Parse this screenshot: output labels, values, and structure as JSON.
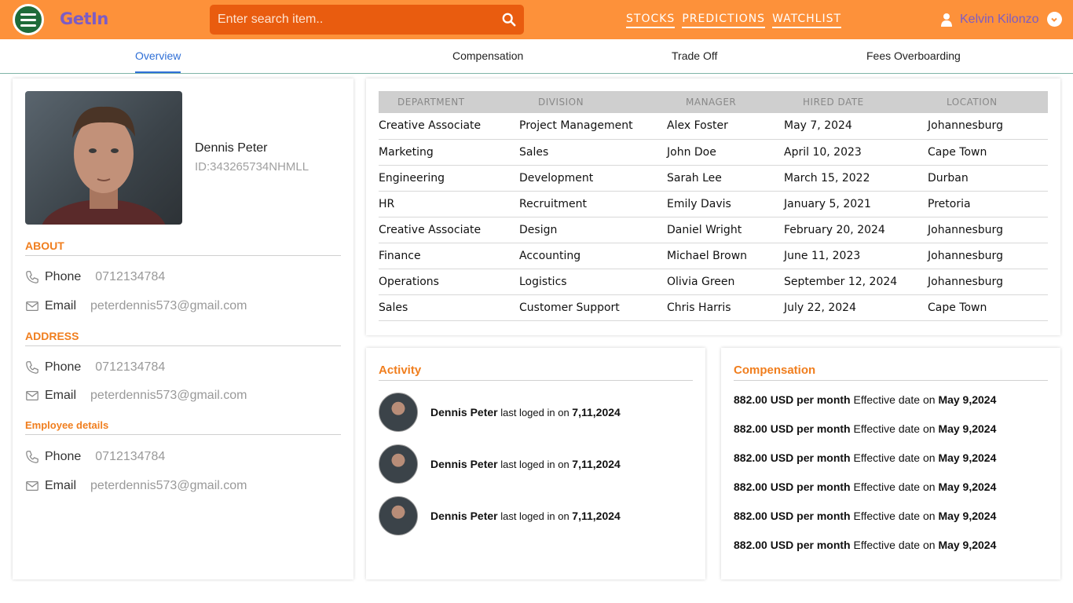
{
  "header": {
    "brand": "GetIn",
    "search_placeholder": "Enter search item..",
    "nav": [
      "STOCKS",
      "PREDICTIONS",
      "WATCHLIST"
    ],
    "user_name": "Kelvin Kilonzo"
  },
  "tabs": [
    "Overview",
    "Compensation",
    "Trade Off",
    "Fees Overboarding"
  ],
  "profile": {
    "name": "Dennis Peter",
    "id": "ID:343265734NHMLL",
    "sections": [
      {
        "title": "ABOUT",
        "phone_label": "Phone",
        "phone": "0712134784",
        "email_label": "Email",
        "email": "peterdennis573@gmail.com"
      },
      {
        "title": "ADDRESS",
        "phone_label": "Phone",
        "phone": "0712134784",
        "email_label": "Email",
        "email": "peterdennis573@gmail.com"
      },
      {
        "title": "Employee details",
        "phone_label": "Phone",
        "phone": "0712134784",
        "email_label": "Email",
        "email": "peterdennis573@gmail.com"
      }
    ]
  },
  "table": {
    "headers": [
      "DEPARTMENT",
      "DIVISION",
      "MANAGER",
      "HIRED DATE",
      "LOCATION"
    ],
    "rows": [
      [
        "Creative Associate",
        "Project Management",
        "Alex Foster",
        "May 7, 2024",
        "Johannesburg"
      ],
      [
        "Marketing",
        "Sales",
        "John Doe",
        "April 10, 2023",
        "Cape Town"
      ],
      [
        "Engineering",
        "Development",
        "Sarah Lee",
        "March 15, 2022",
        "Durban"
      ],
      [
        "HR",
        "Recruitment",
        "Emily Davis",
        "January 5, 2021",
        "Pretoria"
      ],
      [
        "Creative Associate",
        "Design",
        "Daniel Wright",
        "February 20, 2024",
        "Johannesburg"
      ],
      [
        "Finance",
        "Accounting",
        "Michael Brown",
        "June 11, 2023",
        "Johannesburg"
      ],
      [
        "Operations",
        "Logistics",
        "Olivia Green",
        "September 12, 2024",
        "Johannesburg"
      ],
      [
        "Sales",
        "Customer Support",
        "Chris Harris",
        "July 22, 2024",
        "Cape Town"
      ]
    ]
  },
  "activity": {
    "title": "Activity",
    "items": [
      {
        "name": "Dennis Peter",
        "text": "last loged in on",
        "date": "7,11,2024"
      },
      {
        "name": "Dennis Peter",
        "text": "last loged in on",
        "date": "7,11,2024"
      },
      {
        "name": "Dennis Peter",
        "text": "last loged in on",
        "date": "7,11,2024"
      }
    ]
  },
  "compensation": {
    "title": "Compensation",
    "items": [
      {
        "amount": "882.00 USD per month",
        "text": "Effective date on",
        "date": "May 9,2024"
      },
      {
        "amount": "882.00 USD per month",
        "text": "Effective date on",
        "date": "May 9,2024"
      },
      {
        "amount": "882.00 USD per month",
        "text": "Effective date on",
        "date": "May 9,2024"
      },
      {
        "amount": "882.00 USD per month",
        "text": "Effective date on",
        "date": "May 9,2024"
      },
      {
        "amount": "882.00 USD per month",
        "text": "Effective date on",
        "date": "May 9,2024"
      },
      {
        "amount": "882.00 USD per month",
        "text": "Effective date on",
        "date": "May 9,2024"
      }
    ]
  }
}
